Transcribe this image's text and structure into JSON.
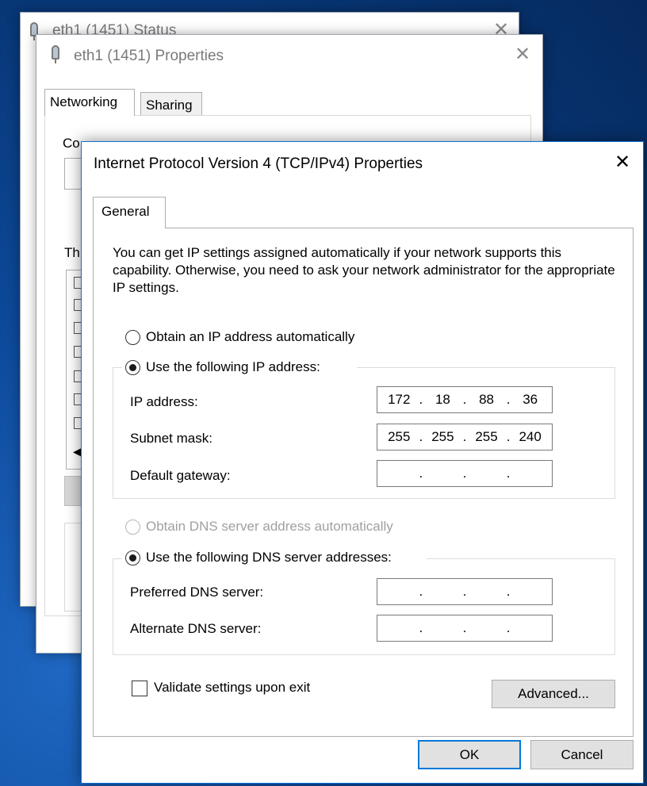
{
  "status_window": {
    "title": "eth1 (1451) Status"
  },
  "properties_window": {
    "title": "eth1 (1451) Properties",
    "tabs": [
      "Networking",
      "Sharing"
    ],
    "partial_connect_label": "Co",
    "partial_items_label": "Th"
  },
  "ipv4_dialog": {
    "title": "Internet Protocol Version 4 (TCP/IPv4) Properties",
    "tab": "General",
    "info_text": "You can get IP settings assigned automatically if your network supports this capability. Otherwise, you need to ask your network administrator for the appropriate IP settings.",
    "ip_mode": {
      "auto_label": "Obtain an IP address automatically",
      "manual_label": "Use the following IP address:",
      "selected": "manual"
    },
    "ip_fields": {
      "ip_address": {
        "label": "IP address:",
        "octets": [
          "172",
          "18",
          "88",
          "36"
        ]
      },
      "subnet_mask": {
        "label": "Subnet mask:",
        "octets": [
          "255",
          "255",
          "255",
          "240"
        ]
      },
      "default_gateway": {
        "label": "Default gateway:",
        "octets": [
          "",
          "",
          "",
          ""
        ]
      }
    },
    "dns_mode": {
      "auto_label": "Obtain DNS server address automatically",
      "manual_label": "Use the following DNS server addresses:",
      "selected": "manual"
    },
    "dns_fields": {
      "preferred": {
        "label": "Preferred DNS server:",
        "octets": [
          "",
          "",
          "",
          ""
        ]
      },
      "alternate": {
        "label": "Alternate DNS server:",
        "octets": [
          "",
          "",
          "",
          ""
        ]
      }
    },
    "validate_label": "Validate settings upon exit",
    "validate_checked": false,
    "buttons": {
      "advanced": "Advanced...",
      "ok": "OK",
      "cancel": "Cancel"
    }
  },
  "icons": {
    "network": "network-adapter-icon",
    "close": "close-icon"
  },
  "colors": {
    "desktop": "#0a3f86",
    "accent": "#0078d7"
  }
}
